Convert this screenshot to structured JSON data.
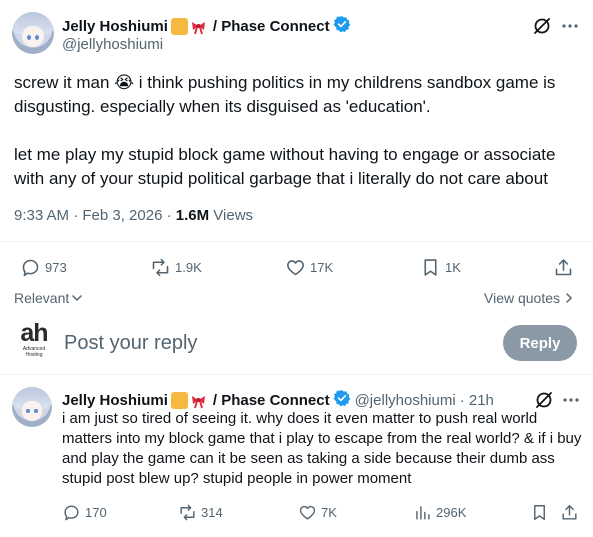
{
  "post": {
    "display_name": "Jelly Hoshiumi",
    "affiliation": "/ Phase Connect",
    "handle": "@jellyhoshiumi",
    "paragraph1": "screw it man 😭 i think pushing politics in my childrens sandbox game is disgusting. especially when its disguised as 'education'.",
    "paragraph2": "let me play my stupid block game without having to engage or associate with any of your stupid political garbage that i literally do not care about",
    "time": "9:33 AM · Feb 3, 2026 · ",
    "views_count": "1.6M",
    "views_label": " Views",
    "stats": {
      "replies": "973",
      "reposts": "1.9K",
      "likes": "17K",
      "bookmarks": "1K"
    }
  },
  "controls": {
    "sort_label": "Relevant",
    "view_quotes": "View quotes"
  },
  "composer": {
    "logo_letters": "ah",
    "logo_caption": "Advanced\nHosting",
    "placeholder": "Post your reply",
    "reply_button": "Reply"
  },
  "reply": {
    "display_name": "Jelly Hoshiumi",
    "affiliation": "/ Phase Connect",
    "handle": "@jellyhoshiumi",
    "time": "· 21h",
    "text": "i am just so tired of seeing it. why does it even matter to push real world matters into my block game that i play to escape from the real world? & if i buy and play the game can it be seen as taking a side because their dumb ass stupid post blew up? stupid people in power moment",
    "stats": {
      "replies": "170",
      "reposts": "314",
      "likes": "7K",
      "views": "296K"
    }
  },
  "colors": {
    "verified": "#1d9bf0",
    "secondary_text": "#536471",
    "reply_button_bg": "#8b98a5",
    "divider": "#eff3f4"
  },
  "icons": [
    "grok-icon",
    "more-icon",
    "verified-badge-icon",
    "reply-icon",
    "repost-icon",
    "like-icon",
    "bookmark-icon",
    "share-icon",
    "chevron-down-icon",
    "chevron-right-icon",
    "views-icon"
  ]
}
